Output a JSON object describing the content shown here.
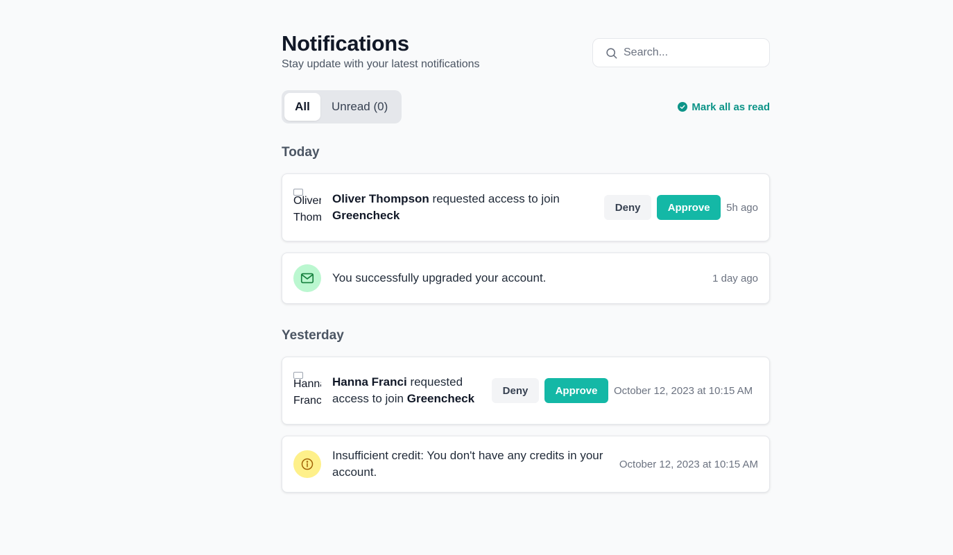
{
  "header": {
    "title": "Notifications",
    "subtitle": "Stay update with your latest notifications"
  },
  "search": {
    "placeholder": "Search...",
    "value": ""
  },
  "tabs": [
    {
      "label": "All",
      "active": true
    },
    {
      "label": "Unread (0)",
      "active": false
    }
  ],
  "mark_all_read": {
    "label": "Mark all as read",
    "icon": "check-circle-icon",
    "color": "#0d9488"
  },
  "sections": {
    "today": {
      "title": "Today",
      "items": [
        {
          "type": "access-request",
          "avatar_alt": "Oliver Thompson",
          "name": "Oliver Thompson",
          "text": "requested access to join",
          "group": "Greencheck",
          "deny_label": "Deny",
          "approve_label": "Approve",
          "time": "5h ago"
        },
        {
          "type": "message",
          "icon": "mail-icon",
          "text": "You successfully upgraded your account.",
          "time": "1 day ago"
        }
      ]
    },
    "yesterday": {
      "title": "Yesterday",
      "items": [
        {
          "type": "access-request",
          "avatar_alt": "Hanna Franci",
          "name": "Hanna Franci",
          "text": "requested access to join",
          "group": "Greencheck",
          "deny_label": "Deny",
          "approve_label": "Approve",
          "time": "October 12, 2023 at 10:15 AM"
        },
        {
          "type": "warning",
          "icon": "info-icon",
          "text": "Insufficient credit: You don't have any credits in your account.",
          "time": "October 12, 2023 at 10:15 AM"
        }
      ]
    }
  },
  "colors": {
    "accent": "#14b8a6",
    "mail_bg": "#bbf7d0",
    "info_bg": "#fef08a"
  }
}
